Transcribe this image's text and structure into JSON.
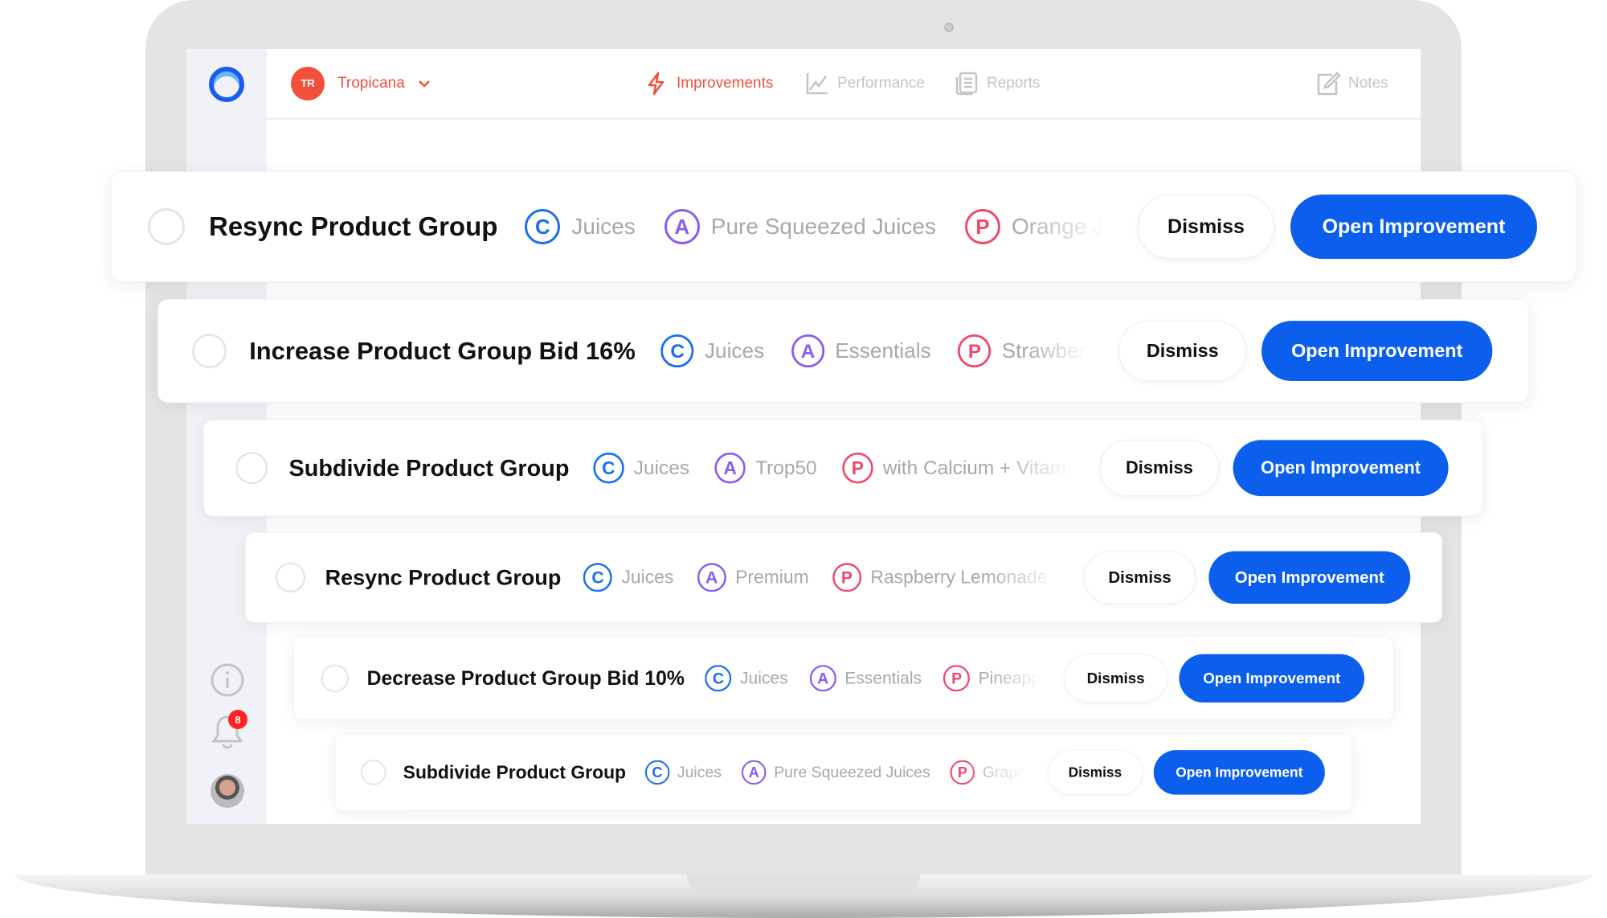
{
  "header": {
    "account_initials": "TR",
    "account_name": "Tropicana",
    "nav": [
      {
        "label": "Improvements",
        "icon": "lightning-icon",
        "active": true
      },
      {
        "label": "Performance",
        "icon": "chart-icon"
      },
      {
        "label": "Reports",
        "icon": "reports-icon"
      },
      {
        "label": "Notes",
        "icon": "edit-icon"
      }
    ]
  },
  "sidebar": {
    "notification_count": "8"
  },
  "colors": {
    "accent": "#0b5fec",
    "brand": "#f2503a",
    "tag_c": "#1a6ff0",
    "tag_a": "#8a5cf0",
    "tag_p": "#f0476a"
  },
  "labels": {
    "dismiss": "Dismiss",
    "open": "Open Improvement",
    "c": "C",
    "a": "A",
    "p": "P"
  },
  "cards": [
    {
      "title": "Resync Product Group",
      "c": "Juices",
      "a": "Pure Squeezed Juices",
      "p": "Orange Juice"
    },
    {
      "title": "Increase Product Group Bid 16%",
      "c": "Juices",
      "a": "Essentials",
      "p": "Strawberry"
    },
    {
      "title": "Subdivide Product Group",
      "c": "Juices",
      "a": "Trop50",
      "p": "with Calcium + Vitamin D"
    },
    {
      "title": "Resync Product Group",
      "c": "Juices",
      "a": "Premium",
      "p": "Raspberry Lemonade"
    },
    {
      "title": "Decrease Product Group Bid 10%",
      "c": "Juices",
      "a": "Essentials",
      "p": "Pineapple"
    },
    {
      "title": "Subdivide Product Group",
      "c": "Juices",
      "a": "Pure Squeezed Juices",
      "p": "Grapefruit"
    }
  ]
}
